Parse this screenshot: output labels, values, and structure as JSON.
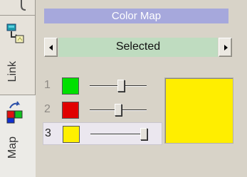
{
  "tabs": {
    "link_label": "Link",
    "map_label": "Map"
  },
  "colormap": {
    "title": "Color Map",
    "selector_value": "Selected",
    "preview_color": "#ffee00",
    "entries": [
      {
        "index": "1",
        "color": "#00e000",
        "slider_level": 0.55
      },
      {
        "index": "2",
        "color": "#e00000",
        "slider_level": 0.5
      },
      {
        "index": "3",
        "color": "#fff000",
        "slider_level": 1.0
      }
    ]
  }
}
